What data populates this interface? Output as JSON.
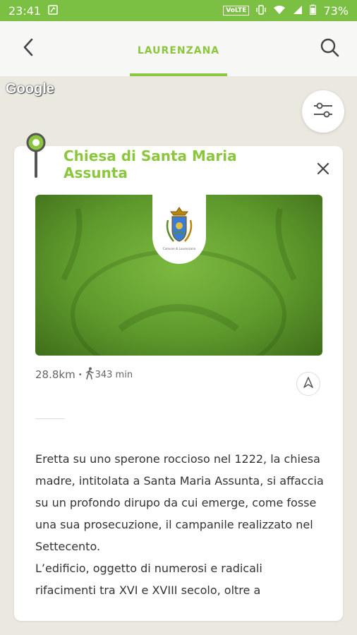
{
  "status_bar": {
    "time": "23:41",
    "vote_label": "VoLTE",
    "battery": "73%"
  },
  "header": {
    "title": "LAURENZANA"
  },
  "map": {
    "provider_logo": "Google"
  },
  "card": {
    "title": "Chiesa di Santa Maria Assunta",
    "image_caption": "Comune di Laurenzana",
    "distance": "28.8km",
    "walk_time": "343 min",
    "description": "Eretta su uno sperone roccioso nel 1222, la chiesa madre, intitolata a Santa Maria Assunta, si affaccia su un profondo dirupo da cui emerge, come fosse una sua prosecuzione, il campanile realizzato nel Settecento.\nL’edificio, oggetto di numerosi e radicali rifacimenti tra XVI e XVIII secolo, oltre a"
  },
  "colors": {
    "accent": "#8cc63f",
    "status_bar": "#7bc043",
    "map_background": "#ebe8e0"
  },
  "icons": {
    "back": "arrow-back-icon",
    "search": "search-icon",
    "filter": "sliders-icon",
    "close": "close-icon",
    "walk": "walk-icon",
    "navigate": "navigation-arrow-icon",
    "pin": "map-pin-icon"
  }
}
